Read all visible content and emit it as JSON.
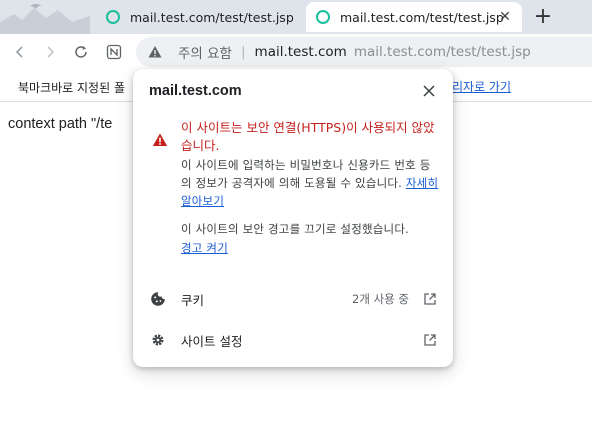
{
  "tabs": [
    {
      "title": "mail.test.com/test/test.jsp",
      "active": false
    },
    {
      "title": "mail.test.com/test/test.jsp",
      "active": true
    }
  ],
  "omnibox": {
    "security_status": "주의 요함",
    "separator": "|",
    "domain": "mail.test.com",
    "url": "mail.test.com/test/test.jsp"
  },
  "bookmarks_bar": {
    "message": "북마크바로 지정된 폴",
    "link": "리자로 가기"
  },
  "page": {
    "text": "context path \"/te"
  },
  "popup": {
    "title": "mail.test.com",
    "warning_title": "이 사이트는 보안 연결(HTTPS)이 사용되지 않았습니다.",
    "warning_desc": "이 사이트에 입력하는 비밀번호나 신용카드 번호 등의 정보가 공격자에 의해 도용될 수 있습니다.",
    "learn_more": "자세히 알아보기",
    "warnings_off_text": "이 사이트의 보안 경고를 끄기로 설정했습니다.",
    "turn_on_warnings": "경고 켜기",
    "cookies_label": "쿠키",
    "cookies_value": "2개 사용 중",
    "site_settings_label": "사이트 설정"
  },
  "colors": {
    "warning_red": "#c5221f",
    "link_blue": "#1a5ed6",
    "favicon_teal": "#1bbf9c",
    "tabstrip_bg": "#dfe3ea"
  }
}
